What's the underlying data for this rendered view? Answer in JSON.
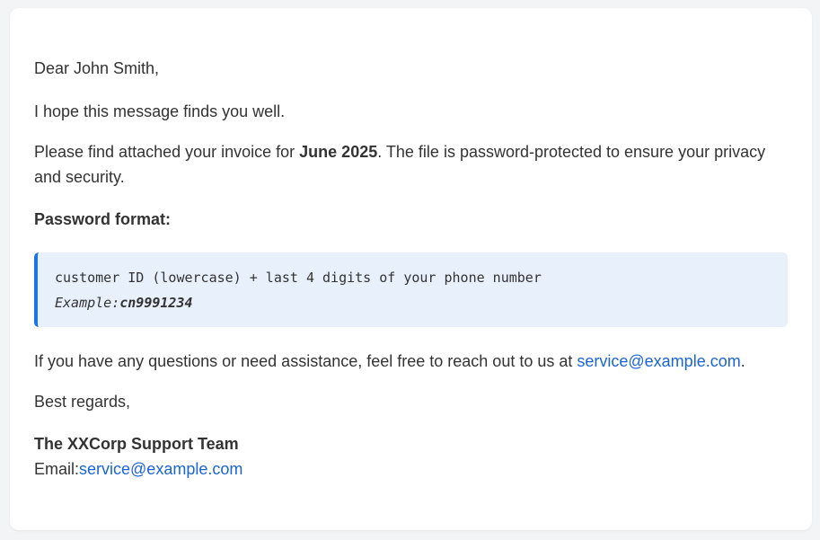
{
  "email": {
    "greeting": "Dear John Smith,",
    "intro": "I hope this message finds you well.",
    "attached_prefix": "Please find attached your invoice for ",
    "invoice_month": "June 2025",
    "attached_suffix": ". The file is password-protected to ensure your privacy and security.",
    "password_heading": "Password format:",
    "password_format": "customer ID (lowercase) + last 4 digits of your phone number",
    "example_label": "Example:",
    "example_value": "cn9991234",
    "contact_prefix": "If you have any questions or need assistance, feel free to reach out to us at ",
    "contact_email": "service@example.com",
    "contact_suffix": ".",
    "closing": "Best regards,",
    "signature_team": "The XXCorp Support Team",
    "signature_email_label": "Email:",
    "signature_email": "service@example.com"
  },
  "colors": {
    "link": "#1a64d6",
    "accent": "#1a73e8",
    "box_background": "#e8f0fc",
    "text": "#333333"
  }
}
